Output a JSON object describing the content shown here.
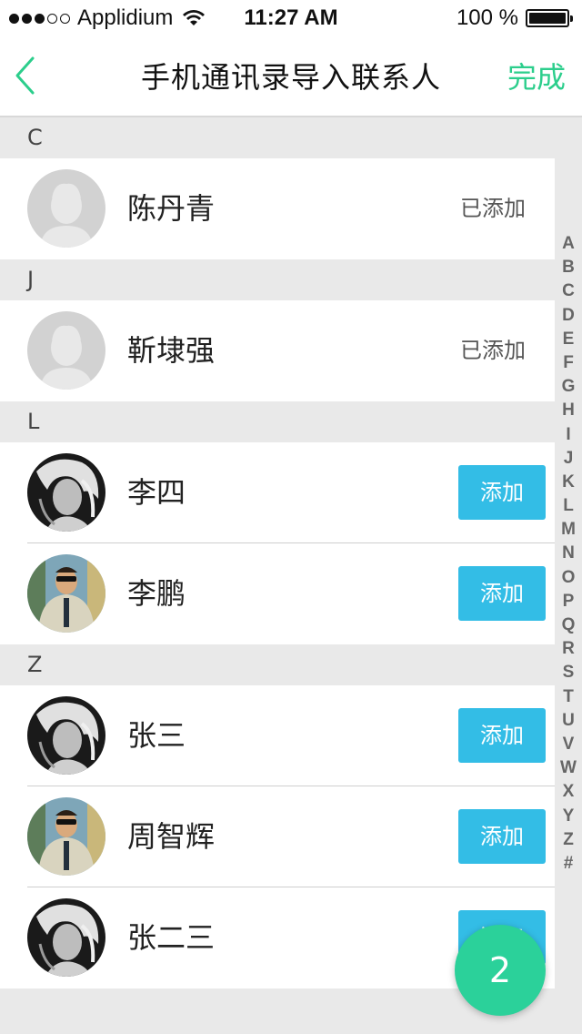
{
  "status_bar": {
    "carrier": "Applidium",
    "time": "11:27 AM",
    "battery_text": "100 %",
    "battery_level": 1.0,
    "signal_strength": 3,
    "signal_max": 5
  },
  "nav": {
    "back_icon": "chevron-left-icon",
    "title": "手机通讯录导入联系人",
    "done_label": "完成"
  },
  "colors": {
    "accent_green": "#2cce8c",
    "add_button_blue": "#33bde6",
    "badge_green": "#2bd19a",
    "section_bg": "#e9e9e9"
  },
  "sections": [
    {
      "letter": "C",
      "contacts": [
        {
          "name": "陈丹青",
          "status": "已添加",
          "avatar": "placeholder-avatar"
        }
      ]
    },
    {
      "letter": "J",
      "contacts": [
        {
          "name": "靳埭强",
          "status": "已添加",
          "avatar": "placeholder-avatar"
        }
      ]
    },
    {
      "letter": "L",
      "contacts": [
        {
          "name": "李四",
          "status": "添加",
          "avatar": "woman-photo-avatar"
        },
        {
          "name": "李鹏",
          "status": "添加",
          "avatar": "man-photo-avatar"
        }
      ]
    },
    {
      "letter": "Z",
      "contacts": [
        {
          "name": "张三",
          "status": "添加",
          "avatar": "woman-photo-avatar"
        },
        {
          "name": "周智辉",
          "status": "添加",
          "avatar": "man-photo-avatar"
        },
        {
          "name": "张二三",
          "status": "添加",
          "avatar": "woman-photo-avatar"
        }
      ]
    }
  ],
  "added_label": "已添加",
  "add_label": "添加",
  "index_letters": [
    "A",
    "B",
    "C",
    "D",
    "E",
    "F",
    "G",
    "H",
    "I",
    "J",
    "K",
    "L",
    "M",
    "N",
    "O",
    "P",
    "Q",
    "R",
    "S",
    "T",
    "U",
    "V",
    "W",
    "X",
    "Y",
    "Z",
    "#"
  ],
  "selected_count": "2"
}
